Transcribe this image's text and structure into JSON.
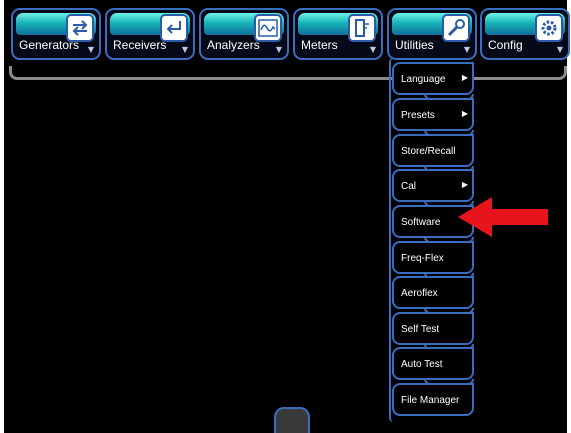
{
  "toolbar": {
    "tabs": [
      {
        "label": "Generators",
        "icon": "generators-icon"
      },
      {
        "label": "Receivers",
        "icon": "receivers-icon"
      },
      {
        "label": "Analyzers",
        "icon": "analyzers-icon"
      },
      {
        "label": "Meters",
        "icon": "meters-icon"
      },
      {
        "label": "Utilities",
        "icon": "wrench-icon"
      },
      {
        "label": "Config",
        "icon": "gear-icon"
      }
    ],
    "caret": "▼"
  },
  "utilities_menu": {
    "items": [
      {
        "label": "Language",
        "submenu": "▶"
      },
      {
        "label": "Presets",
        "submenu": "▶"
      },
      {
        "label": "Store/Recall"
      },
      {
        "label": "Cal",
        "submenu": "▶"
      },
      {
        "label": "Software"
      },
      {
        "label": "Freq-Flex"
      },
      {
        "label": "Aeroflex"
      },
      {
        "label": "Self Test"
      },
      {
        "label": "Auto Test"
      },
      {
        "label": "File Manager"
      }
    ]
  },
  "annotation": {
    "arrow_color": "#e8141b",
    "target": "Software"
  },
  "colors": {
    "tab_glow": "#18b3b8",
    "border_blue": "#3a6cbf",
    "background": "#000000"
  }
}
